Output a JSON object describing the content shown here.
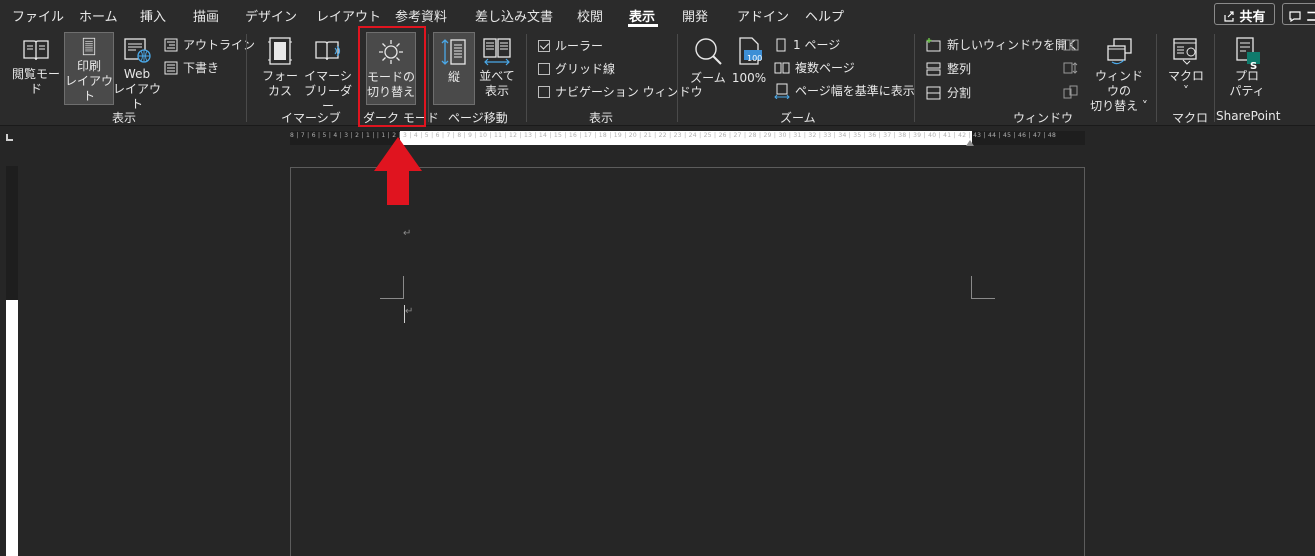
{
  "tabs": [
    {
      "label": "ファイル"
    },
    {
      "label": "ホーム"
    },
    {
      "label": "挿入"
    },
    {
      "label": "描画"
    },
    {
      "label": "デザイン"
    },
    {
      "label": "レイアウト"
    },
    {
      "label": "参考資料"
    },
    {
      "label": "差し込み文書"
    },
    {
      "label": "校閲"
    },
    {
      "label": "表示"
    },
    {
      "label": "開発"
    },
    {
      "label": "アドイン"
    },
    {
      "label": "ヘルプ"
    }
  ],
  "active_tab": "表示",
  "share_label": "共有",
  "comment_label": "コ",
  "ribbon": {
    "views": {
      "read_mode": "閲覧モード",
      "print_layout_1": "印刷",
      "print_layout_2": "レイアウト",
      "web_layout_1": "Web",
      "web_layout_2": "レイアウト",
      "outline": "アウトライン",
      "draft": "下書き",
      "group_label": "表示"
    },
    "immersive": {
      "focus_1": "フォー",
      "focus_2": "カス",
      "reader_1": "イマーシ",
      "reader_2": "ブリーダー",
      "group_label": "イマーシブ"
    },
    "dark_mode": {
      "toggle_1": "モードの",
      "toggle_2": "切り替え",
      "group_label": "ダーク モード"
    },
    "page_movement": {
      "vertical": "縦",
      "side_1": "並べて",
      "side_2": "表示",
      "group_label": "ページ移動"
    },
    "show": {
      "ruler": "ルーラー",
      "gridlines": "グリッド線",
      "nav_pane": "ナビゲーション ウィンドウ",
      "group_label": "表示"
    },
    "zoom": {
      "zoom": "ズーム",
      "hundred": "100%",
      "hundred_icon_text": "100",
      "one_page": "1 ページ",
      "multiple": "複数ページ",
      "page_width": "ページ幅を基準に表示",
      "group_label": "ズーム"
    },
    "window": {
      "new_window": "新しいウィンドウを開く",
      "arrange": "整列",
      "split": "分割",
      "switch_1": "ウィンドウの",
      "switch_2": "切り替え ˅",
      "group_label": "ウィンドウ"
    },
    "macros": {
      "label": "マクロ",
      "chevron": "˅",
      "group_label": "マクロ"
    },
    "sharepoint": {
      "prop_1": "プロ",
      "prop_2": "パティ",
      "badge": "S",
      "group_label": "SharePoint"
    }
  },
  "ruler_text": "8 | 7 | 6 | 5 | 4 | 3 | 2 | 1 |   | 1 | 2 | 3 | 4 | 5 | 6 | 7 | 8 | 9 | 10 | 11 | 12 | 13 | 14 | 15 | 16 | 17 | 18 | 19 | 20 | 21 | 22 | 23 | 24 | 25 | 26 | 27 | 28 | 29 | 30 | 31 | 32 | 33 | 34 | 35 | 36 | 37 | 38 | 39 | 40 | 41 | 42 | 43 | 44 | 45 | 46 | 47 | 48",
  "document": {
    "para_mark": "↵"
  },
  "colors": {
    "highlight": "#e0141f",
    "background": "#262626",
    "ribbon": "#2b2b2b"
  }
}
